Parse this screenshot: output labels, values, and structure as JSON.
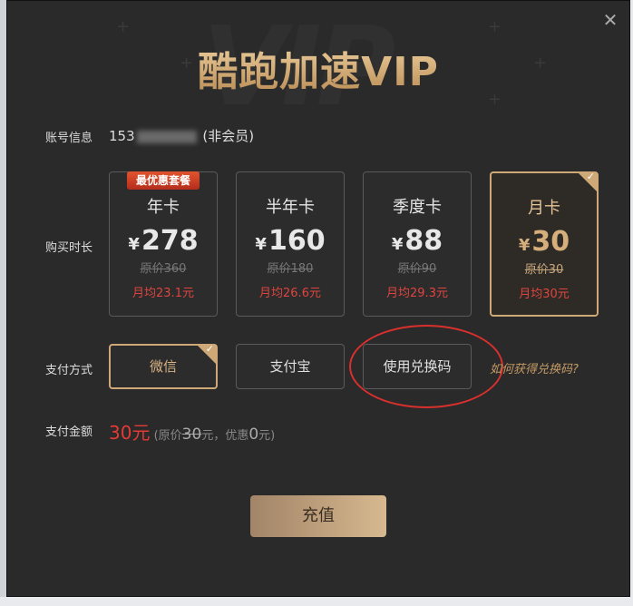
{
  "title": "酷跑加速VIP",
  "account": {
    "label": "账号信息",
    "prefix": "153",
    "status": "(非会员)"
  },
  "duration": {
    "label": "购买时长",
    "plans": [
      {
        "name": "年卡",
        "currency": "¥",
        "price": "278",
        "original": "原价360",
        "monthly": "月均23.1元",
        "badge": "最优惠套餐",
        "selected": false
      },
      {
        "name": "半年卡",
        "currency": "¥",
        "price": "160",
        "original": "原价180",
        "monthly": "月均26.6元",
        "badge": "",
        "selected": false
      },
      {
        "name": "季度卡",
        "currency": "¥",
        "price": "88",
        "original": "原价90",
        "monthly": "月均29.3元",
        "badge": "",
        "selected": false
      },
      {
        "name": "月卡",
        "currency": "¥",
        "price": "30",
        "original": "原价30",
        "monthly": "月均30元",
        "badge": "",
        "selected": true
      }
    ]
  },
  "payment": {
    "label": "支付方式",
    "methods": [
      {
        "name": "微信",
        "selected": true
      },
      {
        "name": "支付宝",
        "selected": false
      },
      {
        "name": "使用兑换码",
        "selected": false
      }
    ],
    "redeem_help": "如何获得兑换码?"
  },
  "amount": {
    "label": "支付金额",
    "total": "30",
    "unit": "元",
    "original_prefix": "(原价",
    "original": "30",
    "discount_prefix": "元，优惠",
    "discount": "0",
    "suffix": "元)"
  },
  "charge_button": "充值",
  "icons": {
    "close": "close-icon",
    "check": "check-icon"
  },
  "colors": {
    "accent": "#cfa877",
    "price_red": "#e0443e",
    "dialog_bg": "#2a2a2b"
  }
}
